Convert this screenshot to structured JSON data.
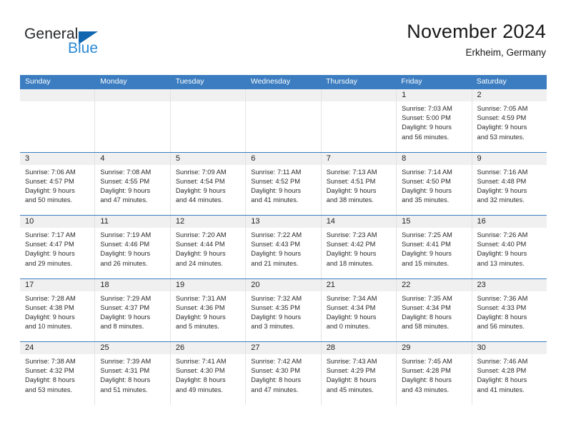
{
  "branding": {
    "name_part1": "General",
    "name_part2": "Blue",
    "triangle_color": "#1266b0",
    "blue_color": "#2b8ad4"
  },
  "header": {
    "title": "November 2024",
    "subtitle": "Erkheim, Germany"
  },
  "theme": {
    "header_blue": "#3b7dc0",
    "day_band_gray": "#f0f0f0",
    "cell_border": "#e2e2e2"
  },
  "weekdays": [
    "Sunday",
    "Monday",
    "Tuesday",
    "Wednesday",
    "Thursday",
    "Friday",
    "Saturday"
  ],
  "weeks": [
    [
      {
        "day": "",
        "empty": true
      },
      {
        "day": "",
        "empty": true
      },
      {
        "day": "",
        "empty": true
      },
      {
        "day": "",
        "empty": true
      },
      {
        "day": "",
        "empty": true
      },
      {
        "day": "1",
        "sunrise": "Sunrise: 7:03 AM",
        "sunset": "Sunset: 5:00 PM",
        "daylight1": "Daylight: 9 hours",
        "daylight2": "and 56 minutes."
      },
      {
        "day": "2",
        "sunrise": "Sunrise: 7:05 AM",
        "sunset": "Sunset: 4:59 PM",
        "daylight1": "Daylight: 9 hours",
        "daylight2": "and 53 minutes."
      }
    ],
    [
      {
        "day": "3",
        "sunrise": "Sunrise: 7:06 AM",
        "sunset": "Sunset: 4:57 PM",
        "daylight1": "Daylight: 9 hours",
        "daylight2": "and 50 minutes."
      },
      {
        "day": "4",
        "sunrise": "Sunrise: 7:08 AM",
        "sunset": "Sunset: 4:55 PM",
        "daylight1": "Daylight: 9 hours",
        "daylight2": "and 47 minutes."
      },
      {
        "day": "5",
        "sunrise": "Sunrise: 7:09 AM",
        "sunset": "Sunset: 4:54 PM",
        "daylight1": "Daylight: 9 hours",
        "daylight2": "and 44 minutes."
      },
      {
        "day": "6",
        "sunrise": "Sunrise: 7:11 AM",
        "sunset": "Sunset: 4:52 PM",
        "daylight1": "Daylight: 9 hours",
        "daylight2": "and 41 minutes."
      },
      {
        "day": "7",
        "sunrise": "Sunrise: 7:13 AM",
        "sunset": "Sunset: 4:51 PM",
        "daylight1": "Daylight: 9 hours",
        "daylight2": "and 38 minutes."
      },
      {
        "day": "8",
        "sunrise": "Sunrise: 7:14 AM",
        "sunset": "Sunset: 4:50 PM",
        "daylight1": "Daylight: 9 hours",
        "daylight2": "and 35 minutes."
      },
      {
        "day": "9",
        "sunrise": "Sunrise: 7:16 AM",
        "sunset": "Sunset: 4:48 PM",
        "daylight1": "Daylight: 9 hours",
        "daylight2": "and 32 minutes."
      }
    ],
    [
      {
        "day": "10",
        "sunrise": "Sunrise: 7:17 AM",
        "sunset": "Sunset: 4:47 PM",
        "daylight1": "Daylight: 9 hours",
        "daylight2": "and 29 minutes."
      },
      {
        "day": "11",
        "sunrise": "Sunrise: 7:19 AM",
        "sunset": "Sunset: 4:46 PM",
        "daylight1": "Daylight: 9 hours",
        "daylight2": "and 26 minutes."
      },
      {
        "day": "12",
        "sunrise": "Sunrise: 7:20 AM",
        "sunset": "Sunset: 4:44 PM",
        "daylight1": "Daylight: 9 hours",
        "daylight2": "and 24 minutes."
      },
      {
        "day": "13",
        "sunrise": "Sunrise: 7:22 AM",
        "sunset": "Sunset: 4:43 PM",
        "daylight1": "Daylight: 9 hours",
        "daylight2": "and 21 minutes."
      },
      {
        "day": "14",
        "sunrise": "Sunrise: 7:23 AM",
        "sunset": "Sunset: 4:42 PM",
        "daylight1": "Daylight: 9 hours",
        "daylight2": "and 18 minutes."
      },
      {
        "day": "15",
        "sunrise": "Sunrise: 7:25 AM",
        "sunset": "Sunset: 4:41 PM",
        "daylight1": "Daylight: 9 hours",
        "daylight2": "and 15 minutes."
      },
      {
        "day": "16",
        "sunrise": "Sunrise: 7:26 AM",
        "sunset": "Sunset: 4:40 PM",
        "daylight1": "Daylight: 9 hours",
        "daylight2": "and 13 minutes."
      }
    ],
    [
      {
        "day": "17",
        "sunrise": "Sunrise: 7:28 AM",
        "sunset": "Sunset: 4:38 PM",
        "daylight1": "Daylight: 9 hours",
        "daylight2": "and 10 minutes."
      },
      {
        "day": "18",
        "sunrise": "Sunrise: 7:29 AM",
        "sunset": "Sunset: 4:37 PM",
        "daylight1": "Daylight: 9 hours",
        "daylight2": "and 8 minutes."
      },
      {
        "day": "19",
        "sunrise": "Sunrise: 7:31 AM",
        "sunset": "Sunset: 4:36 PM",
        "daylight1": "Daylight: 9 hours",
        "daylight2": "and 5 minutes."
      },
      {
        "day": "20",
        "sunrise": "Sunrise: 7:32 AM",
        "sunset": "Sunset: 4:35 PM",
        "daylight1": "Daylight: 9 hours",
        "daylight2": "and 3 minutes."
      },
      {
        "day": "21",
        "sunrise": "Sunrise: 7:34 AM",
        "sunset": "Sunset: 4:34 PM",
        "daylight1": "Daylight: 9 hours",
        "daylight2": "and 0 minutes."
      },
      {
        "day": "22",
        "sunrise": "Sunrise: 7:35 AM",
        "sunset": "Sunset: 4:34 PM",
        "daylight1": "Daylight: 8 hours",
        "daylight2": "and 58 minutes."
      },
      {
        "day": "23",
        "sunrise": "Sunrise: 7:36 AM",
        "sunset": "Sunset: 4:33 PM",
        "daylight1": "Daylight: 8 hours",
        "daylight2": "and 56 minutes."
      }
    ],
    [
      {
        "day": "24",
        "sunrise": "Sunrise: 7:38 AM",
        "sunset": "Sunset: 4:32 PM",
        "daylight1": "Daylight: 8 hours",
        "daylight2": "and 53 minutes."
      },
      {
        "day": "25",
        "sunrise": "Sunrise: 7:39 AM",
        "sunset": "Sunset: 4:31 PM",
        "daylight1": "Daylight: 8 hours",
        "daylight2": "and 51 minutes."
      },
      {
        "day": "26",
        "sunrise": "Sunrise: 7:41 AM",
        "sunset": "Sunset: 4:30 PM",
        "daylight1": "Daylight: 8 hours",
        "daylight2": "and 49 minutes."
      },
      {
        "day": "27",
        "sunrise": "Sunrise: 7:42 AM",
        "sunset": "Sunset: 4:30 PM",
        "daylight1": "Daylight: 8 hours",
        "daylight2": "and 47 minutes."
      },
      {
        "day": "28",
        "sunrise": "Sunrise: 7:43 AM",
        "sunset": "Sunset: 4:29 PM",
        "daylight1": "Daylight: 8 hours",
        "daylight2": "and 45 minutes."
      },
      {
        "day": "29",
        "sunrise": "Sunrise: 7:45 AM",
        "sunset": "Sunset: 4:28 PM",
        "daylight1": "Daylight: 8 hours",
        "daylight2": "and 43 minutes."
      },
      {
        "day": "30",
        "sunrise": "Sunrise: 7:46 AM",
        "sunset": "Sunset: 4:28 PM",
        "daylight1": "Daylight: 8 hours",
        "daylight2": "and 41 minutes."
      }
    ]
  ]
}
